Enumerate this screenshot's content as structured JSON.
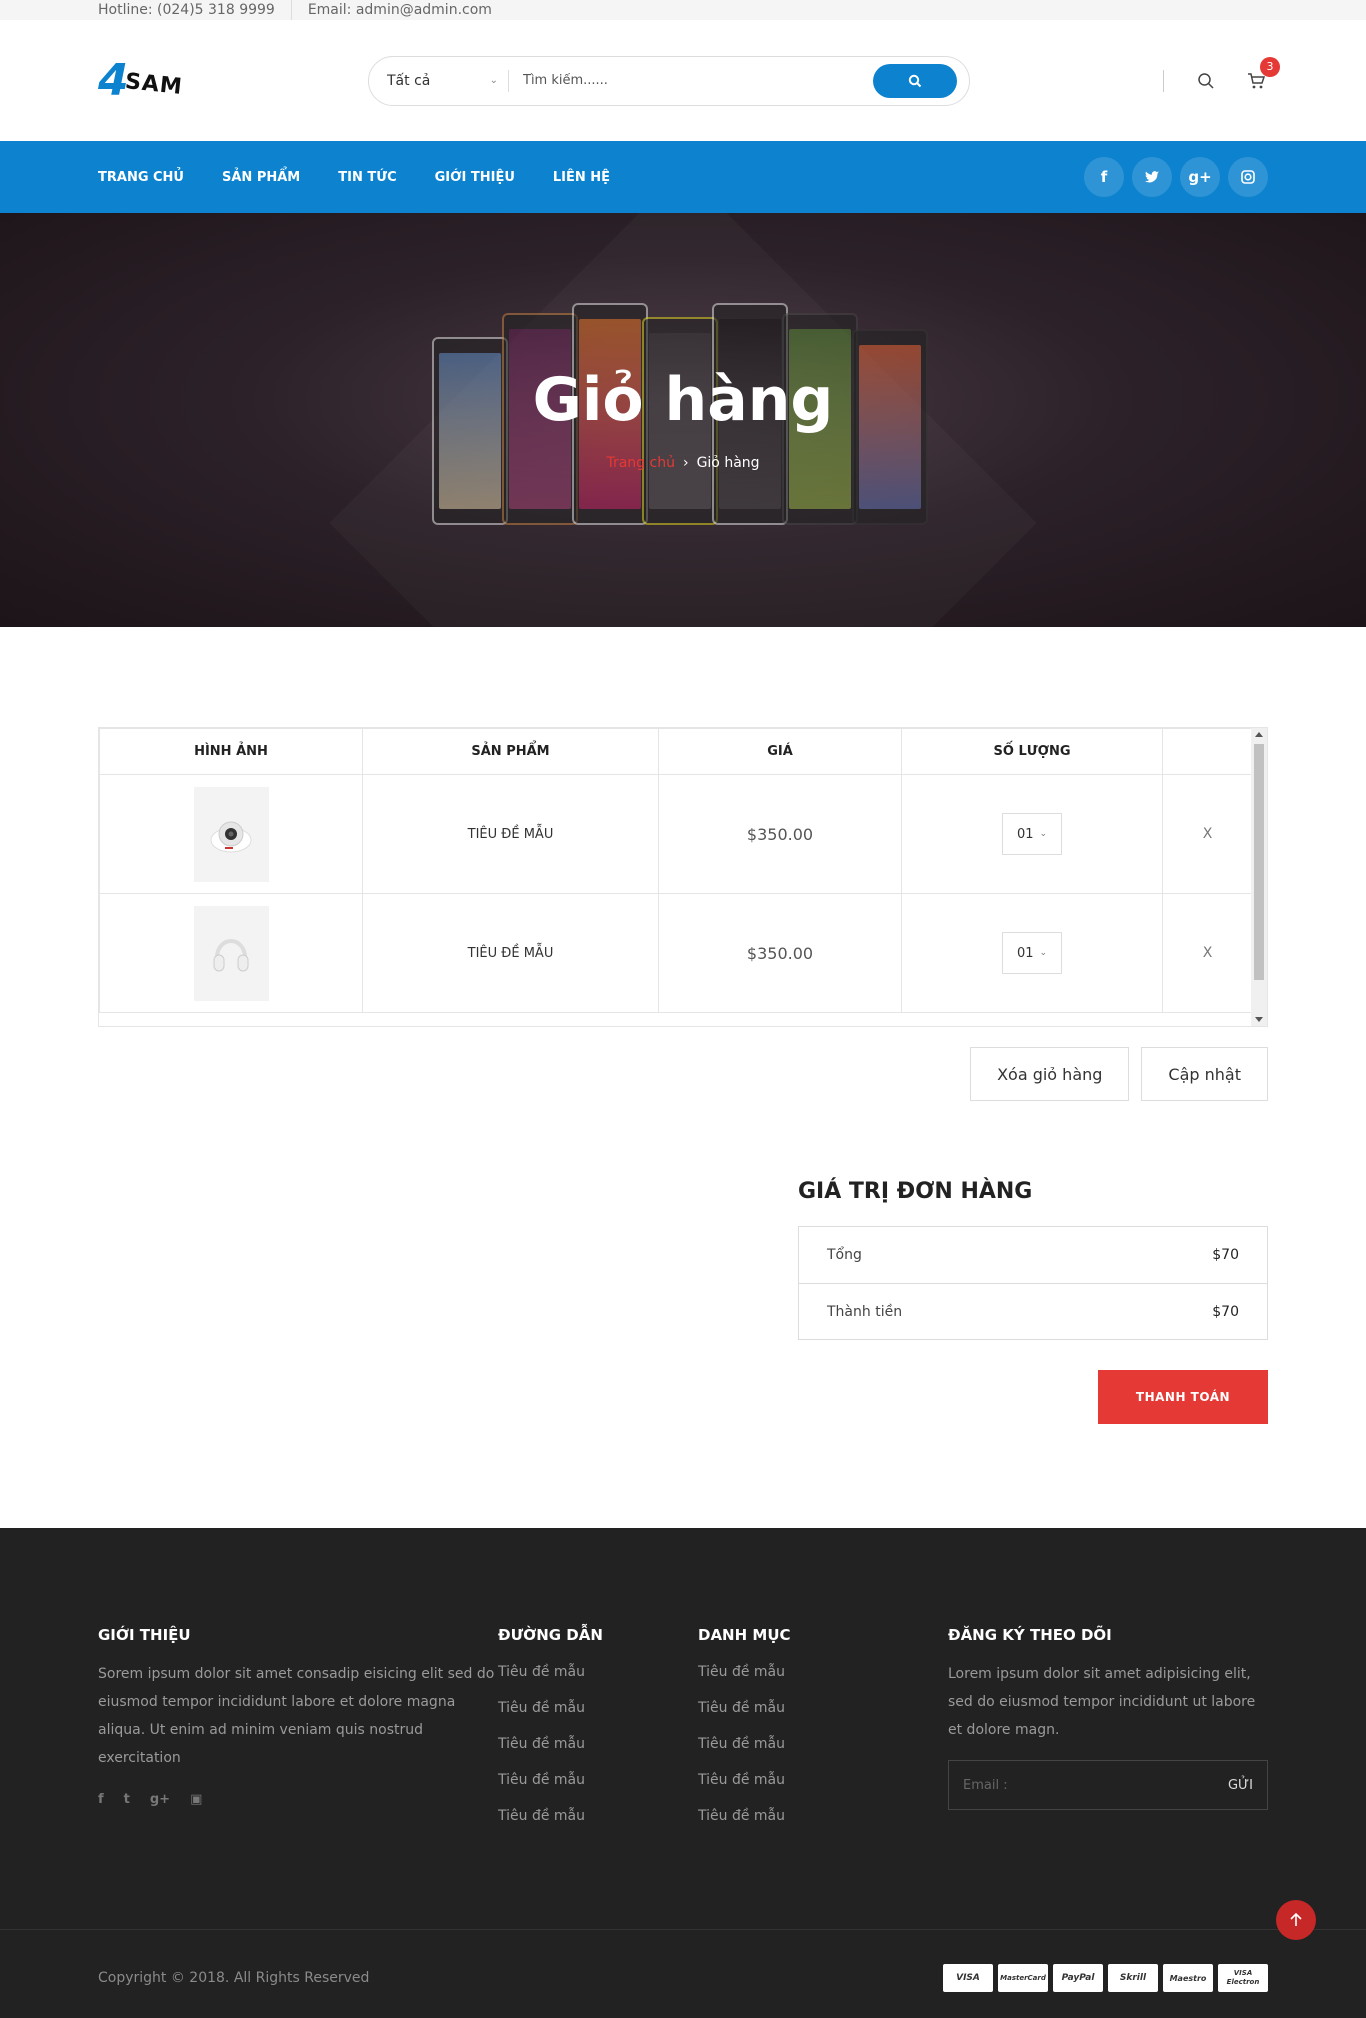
{
  "topbar": {
    "hotline": "Hotline: (024)5 318 9999",
    "email": "Email: admin@admin.com"
  },
  "header": {
    "logo_four": "4",
    "logo_sam": "SAM",
    "search": {
      "category": "Tất cả",
      "placeholder": "Tìm kiếm......",
      "button_icon": "search-icon"
    },
    "cart_count": "3"
  },
  "nav": {
    "items": [
      "TRANG CHỦ",
      "SẢN PHẨM",
      "TIN TỨC",
      "GIỚI THIỆU",
      "LIÊN HỆ"
    ],
    "social": [
      "f",
      "t",
      "g+",
      "ig"
    ]
  },
  "hero": {
    "title": "Giỏ hàng",
    "breadcrumb_home": "Trang chủ",
    "breadcrumb_current": "Giỏ hàng"
  },
  "cart": {
    "headers": [
      "HÌNH ẢNH",
      "SẢN PHẨM",
      "GIÁ",
      "SỐ LƯỢNG",
      ""
    ],
    "rows": [
      {
        "image": "camera",
        "name": "TIÊU ĐỀ MẪU",
        "price": "$350.00",
        "qty": "01",
        "remove": "X"
      },
      {
        "image": "headphones",
        "name": "TIÊU ĐỀ MẪU",
        "price": "$350.00",
        "qty": "01",
        "remove": "X"
      }
    ],
    "clear_label": "Xóa giỏ hàng",
    "update_label": "Cập nhật"
  },
  "totals": {
    "title": "GIÁ TRỊ ĐƠN HÀNG",
    "subtotal_label": "Tổng",
    "subtotal_value": "$70",
    "total_label": "Thành tiền",
    "total_value": "$70",
    "checkout_label": "THANH TOÁN"
  },
  "footer": {
    "about_title": "GIỚI THIỆU",
    "about_text": "Sorem ipsum dolor sit amet consadip eisicing elit sed do eiusmod tempor incididunt labore et dolore magna aliqua. Ut enim ad minim veniam quis nostrud exercitation",
    "links_title": "ĐƯỜNG DẪN",
    "links": [
      "Tiêu đề mẫu",
      "Tiêu đề mẫu",
      "Tiêu đề mẫu",
      "Tiêu đề mẫu",
      "Tiêu đề mẫu"
    ],
    "category_title": "DANH MỤC",
    "categories": [
      "Tiêu đề mẫu",
      "Tiêu đề mẫu",
      "Tiêu đề mẫu",
      "Tiêu đề mẫu",
      "Tiêu đề mẫu"
    ],
    "subscribe_title": "ĐĂNG KÝ THEO DÕI",
    "subscribe_text": "Lorem ipsum dolor sit amet adipisicing elit, sed do eiusmod tempor incididunt ut labore et dolore magn.",
    "email_placeholder": "Email :",
    "send_label": "GỬI",
    "copyright": "Copyright © 2018. All Rights Reserved",
    "payments": [
      "VISA",
      "MasterCard",
      "PayPal",
      "Skrill",
      "Maestro",
      "VISA Electron"
    ]
  }
}
